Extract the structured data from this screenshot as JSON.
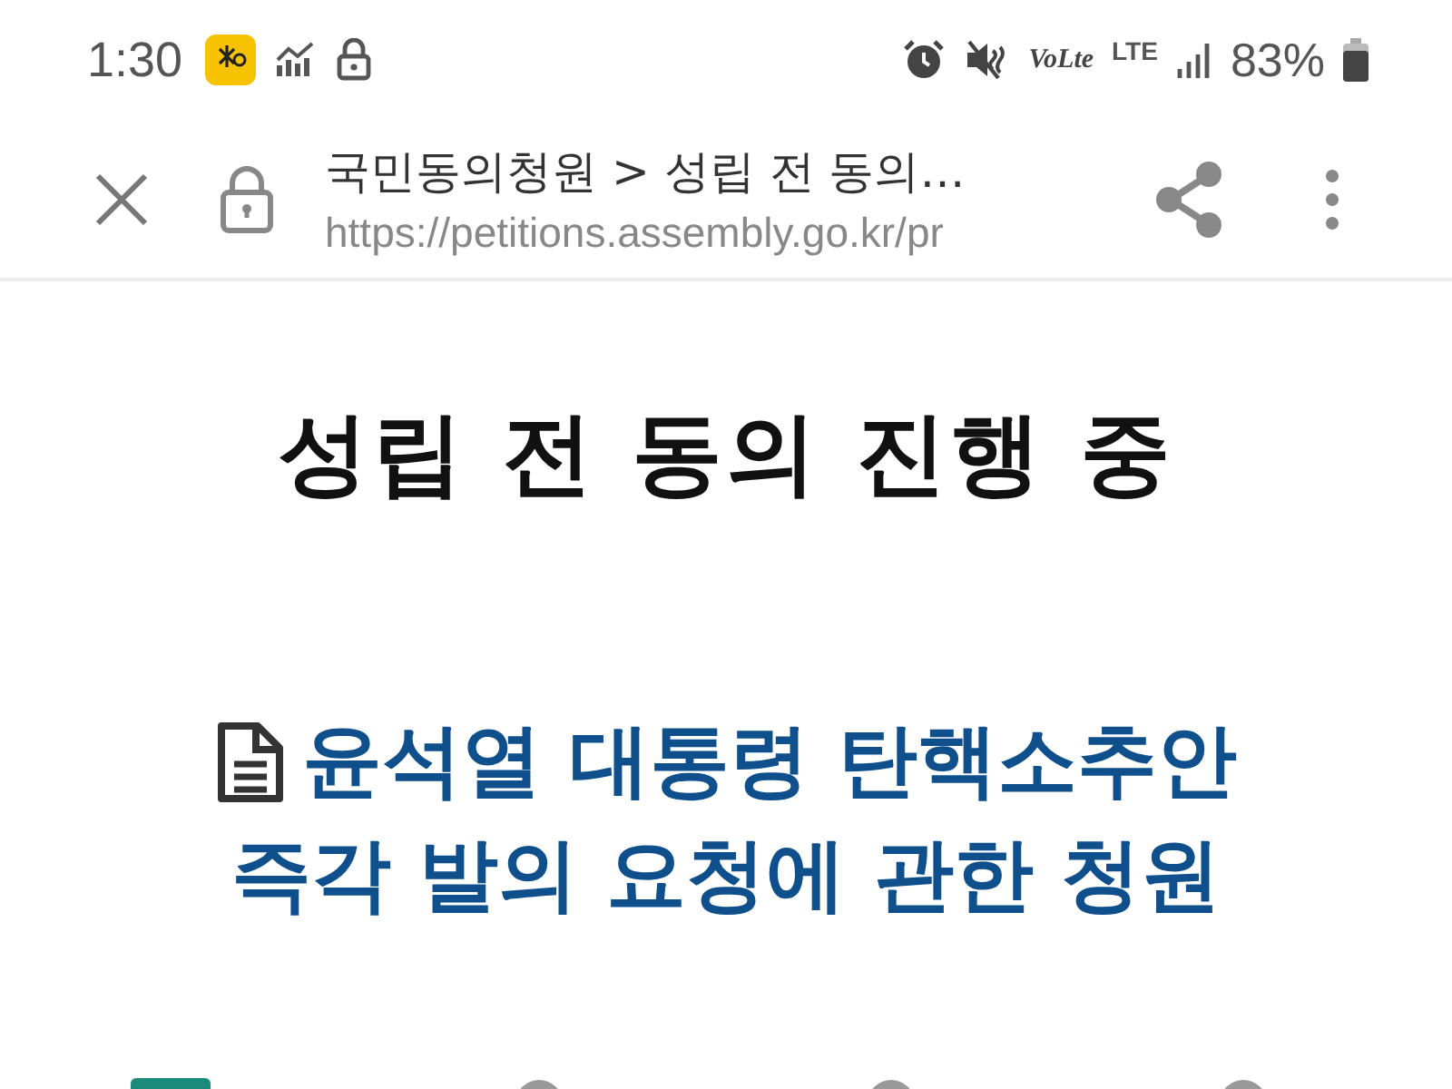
{
  "status_bar": {
    "time": "1:30",
    "volte": "VoLte",
    "network": "LTE",
    "battery": "83%"
  },
  "toolbar": {
    "title": "국민동의청원 > 성립 전 동의…",
    "url": "https://petitions.assembly.go.kr/pr"
  },
  "heading": "성립 전 동의 진행 중",
  "petition": {
    "title_lines": [
      "윤석열 대통령 탄핵소추안",
      "즉각 발의 요청에 관한 청원"
    ]
  }
}
